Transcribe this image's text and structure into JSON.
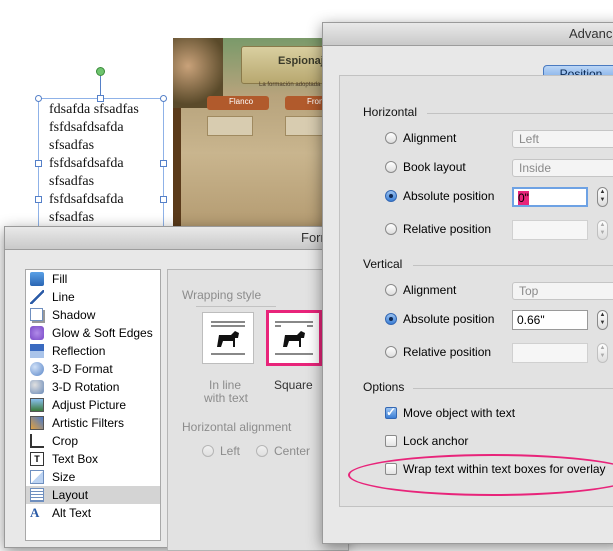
{
  "canvas": {
    "textbox_lines": [
      "fdsafda sfsadfas",
      "fsfdsafdsafda",
      "sfsadfas",
      "fsfdsafdsafda",
      "sfsadfas",
      "fsfdsafdsafda",
      "sfsadfas"
    ],
    "game": {
      "title": "Espionaj",
      "subtitle": "La formación adoptada por",
      "tab1": "Flanco",
      "tab2": "Fron"
    }
  },
  "format_dialog": {
    "title": "Form",
    "categories": [
      {
        "label": "Fill",
        "icon": "fill-bucket-icon"
      },
      {
        "label": "Line",
        "icon": "line-pen-icon"
      },
      {
        "label": "Shadow",
        "icon": "shadow-icon"
      },
      {
        "label": "Glow & Soft Edges",
        "icon": "glow-icon"
      },
      {
        "label": "Reflection",
        "icon": "reflection-icon"
      },
      {
        "label": "3-D Format",
        "icon": "3d-format-icon"
      },
      {
        "label": "3-D Rotation",
        "icon": "3d-rotation-icon"
      },
      {
        "label": "Adjust Picture",
        "icon": "adjust-picture-icon"
      },
      {
        "label": "Artistic Filters",
        "icon": "artistic-filters-icon"
      },
      {
        "label": "Crop",
        "icon": "crop-icon"
      },
      {
        "label": "Text Box",
        "icon": "text-box-icon"
      },
      {
        "label": "Size",
        "icon": "size-icon"
      },
      {
        "label": "Layout",
        "icon": "layout-icon"
      },
      {
        "label": "Alt Text",
        "icon": "alt-text-icon"
      }
    ],
    "selected_category": "Layout",
    "wrapping_style_label": "Wrapping style",
    "wrap_options": [
      {
        "label1": "In line",
        "label2": "with text"
      },
      {
        "label1": "Square",
        "label2": ""
      }
    ],
    "horizontal_alignment_label": "Horizontal alignment",
    "h_align_options": [
      "Left",
      "Center"
    ]
  },
  "advanced_dialog": {
    "title": "Advanc",
    "tab": "Position",
    "horizontal": {
      "heading": "Horizontal",
      "options": [
        {
          "label": "Alignment",
          "value": "Left",
          "selected": false
        },
        {
          "label": "Book layout",
          "value": "Inside",
          "selected": false
        },
        {
          "label": "Absolute position",
          "value": "0\"",
          "selected": true
        },
        {
          "label": "Relative position",
          "value": "",
          "selected": false
        }
      ]
    },
    "vertical": {
      "heading": "Vertical",
      "options": [
        {
          "label": "Alignment",
          "value": "Top",
          "selected": false
        },
        {
          "label": "Absolute position",
          "value": "0.66\"",
          "selected": true
        },
        {
          "label": "Relative position",
          "value": "",
          "selected": false
        }
      ]
    },
    "options": {
      "heading": "Options",
      "move_object": {
        "label": "Move object with text",
        "checked": true
      },
      "lock_anchor": {
        "label": "Lock anchor",
        "checked": false
      },
      "wrap_text": {
        "label": "Wrap text within text boxes for overlay",
        "checked": false
      }
    }
  },
  "colors": {
    "highlight": "#e8247a",
    "accent_blue": "#3b7fd6"
  }
}
